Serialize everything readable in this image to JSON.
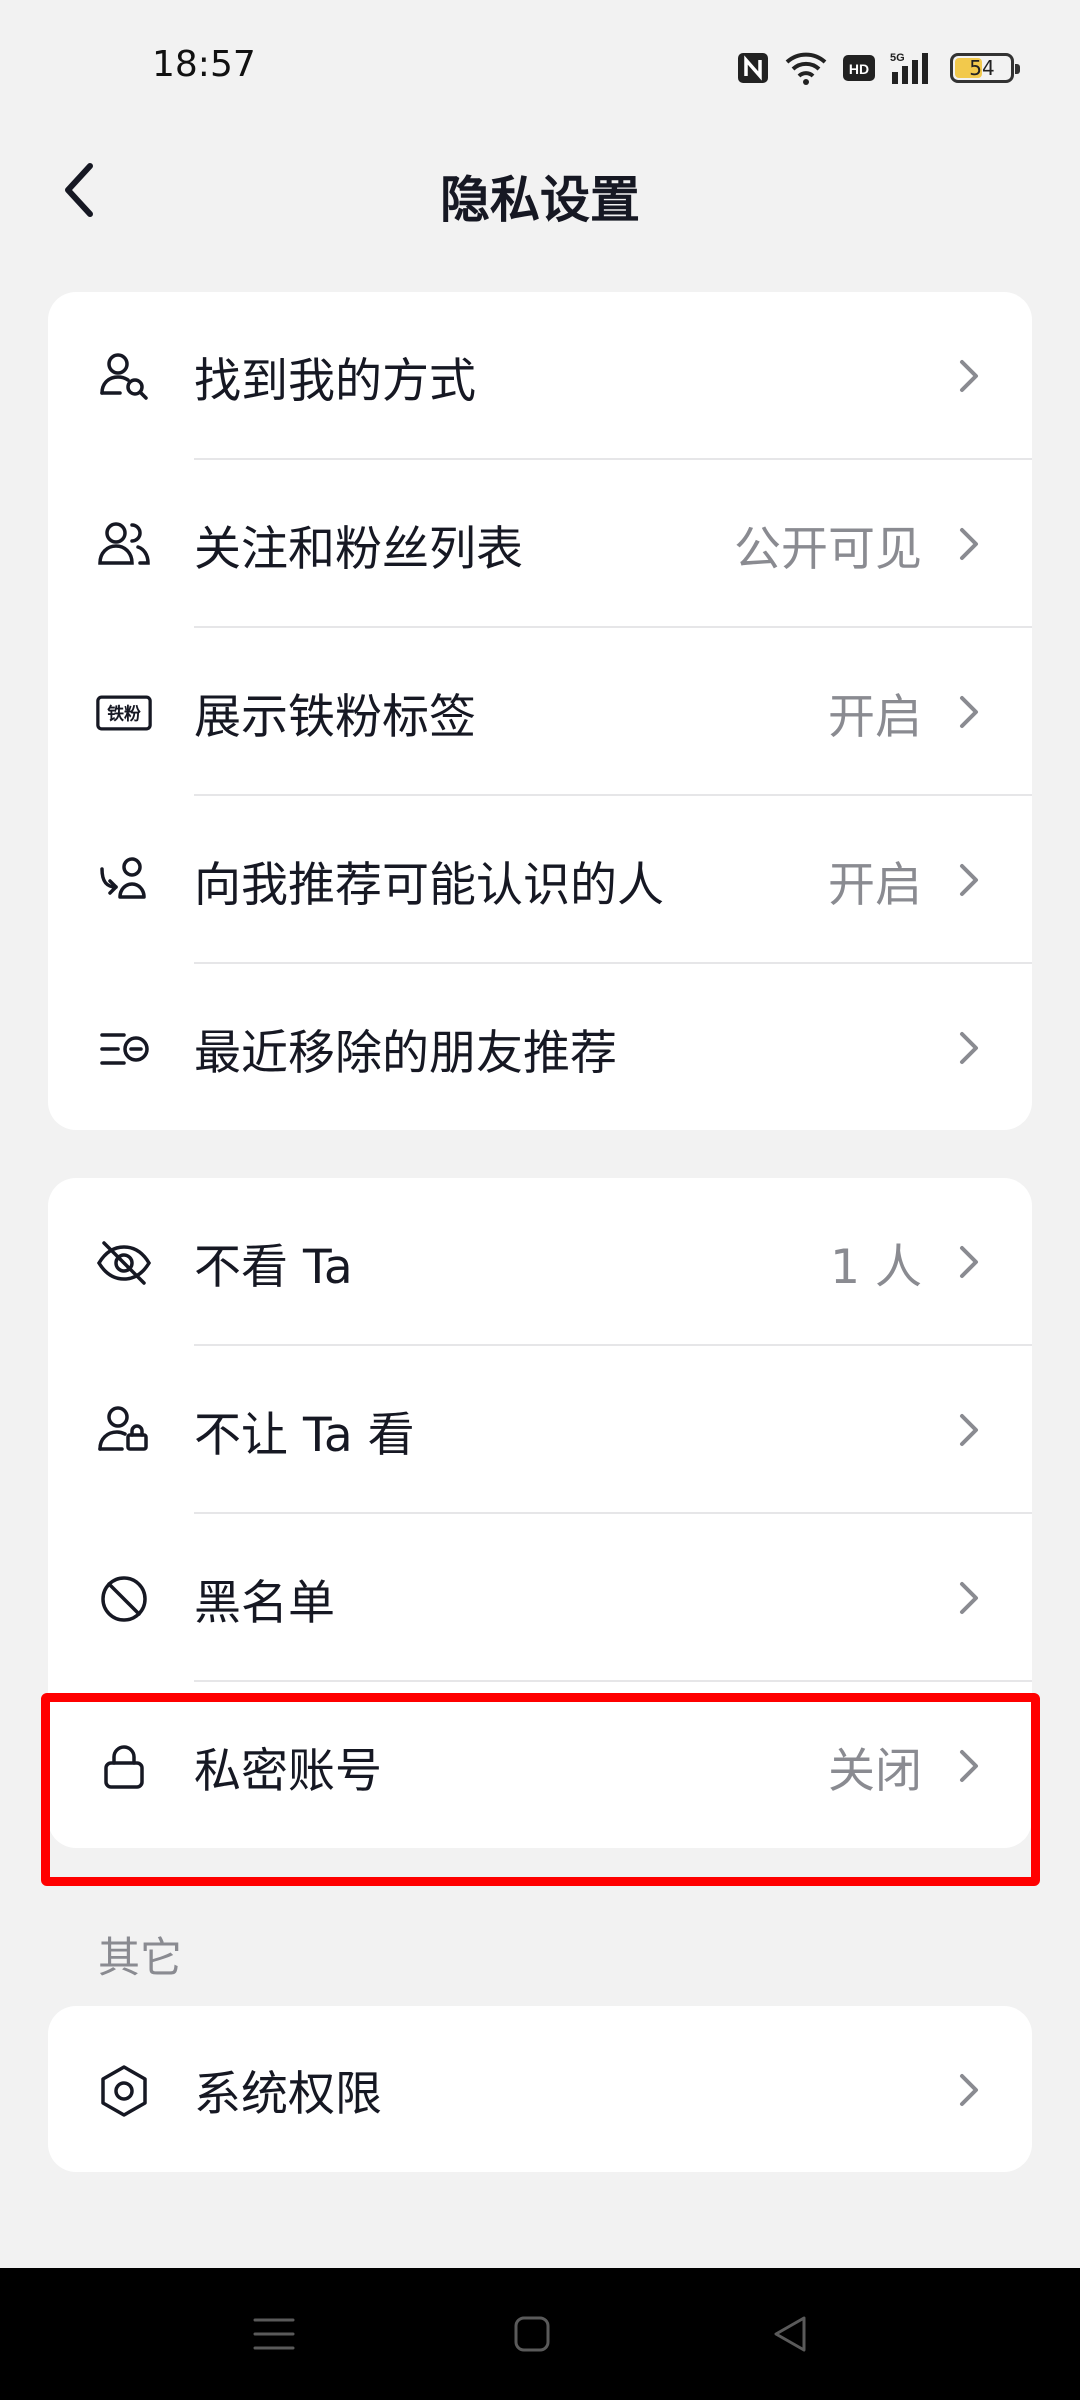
{
  "status_bar": {
    "time": "18:57",
    "battery_level": "54",
    "icons": [
      "nfc-icon",
      "wifi-icon",
      "hd-icon",
      "5g-signal-icon",
      "battery-icon"
    ]
  },
  "header": {
    "title": "隐私设置",
    "back_icon": "chevron-left-icon"
  },
  "card1": [
    {
      "label": "找到我的方式",
      "value": "",
      "icon": "person-search-icon"
    },
    {
      "label": "关注和粉丝列表",
      "value": "公开可见",
      "icon": "people-icon"
    },
    {
      "label": "展示铁粉标签",
      "value": "开启",
      "icon": "iron-fan-badge-icon",
      "badge_text": "铁粉"
    },
    {
      "label": "向我推荐可能认识的人",
      "value": "开启",
      "icon": "recommend-person-icon"
    },
    {
      "label": "最近移除的朋友推荐",
      "value": "",
      "icon": "removed-list-icon"
    }
  ],
  "card2": [
    {
      "label": "不看 Ta",
      "value": "1 人",
      "icon": "eye-slash-icon"
    },
    {
      "label": "不让 Ta 看",
      "value": "",
      "icon": "person-lock-icon"
    },
    {
      "label": "黑名单",
      "value": "",
      "icon": "block-icon"
    },
    {
      "label": "私密账号",
      "value": "关闭",
      "icon": "lock-icon"
    }
  ],
  "section_other": {
    "label": "其它",
    "items": [
      {
        "label": "系统权限",
        "value": "",
        "icon": "hexagon-settings-icon"
      }
    ]
  },
  "highlight": {
    "target": "私密账号",
    "color": "#ff0000"
  },
  "colors": {
    "background": "#f2f2f2",
    "card": "#ffffff",
    "text": "#161823",
    "secondary": "#8a8b91",
    "highlight": "#ff0000"
  }
}
